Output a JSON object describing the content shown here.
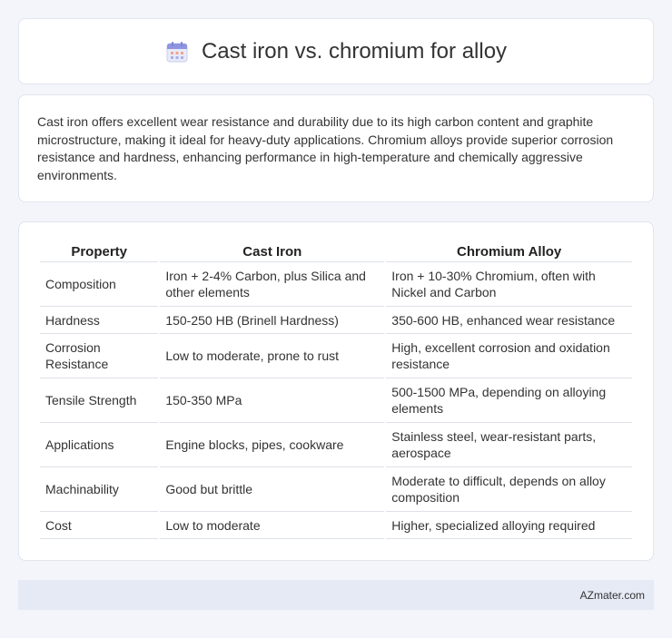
{
  "header": {
    "title": "Cast iron vs. chromium for alloy",
    "icon": "calendar-icon"
  },
  "intro": {
    "text": "Cast iron offers excellent wear resistance and durability due to its high carbon content and graphite microstructure, making it ideal for heavy-duty applications. Chromium alloys provide superior corrosion resistance and hardness, enhancing performance in high-temperature and chemically aggressive environments."
  },
  "table": {
    "headers": [
      "Property",
      "Cast Iron",
      "Chromium Alloy"
    ],
    "rows": [
      [
        "Composition",
        "Iron + 2-4% Carbon, plus Silica and other elements",
        "Iron + 10-30% Chromium, often with Nickel and Carbon"
      ],
      [
        "Hardness",
        "150-250 HB (Brinell Hardness)",
        "350-600 HB, enhanced wear resistance"
      ],
      [
        "Corrosion Resistance",
        "Low to moderate, prone to rust",
        "High, excellent corrosion and oxidation resistance"
      ],
      [
        "Tensile Strength",
        "150-350 MPa",
        "500-1500 MPa, depending on alloying elements"
      ],
      [
        "Applications",
        "Engine blocks, pipes, cookware",
        "Stainless steel, wear-resistant parts, aerospace"
      ],
      [
        "Machinability",
        "Good but brittle",
        "Moderate to difficult, depends on alloy composition"
      ],
      [
        "Cost",
        "Low to moderate",
        "Higher, specialized alloying required"
      ]
    ]
  },
  "footer": {
    "text": "AZmater.com"
  }
}
